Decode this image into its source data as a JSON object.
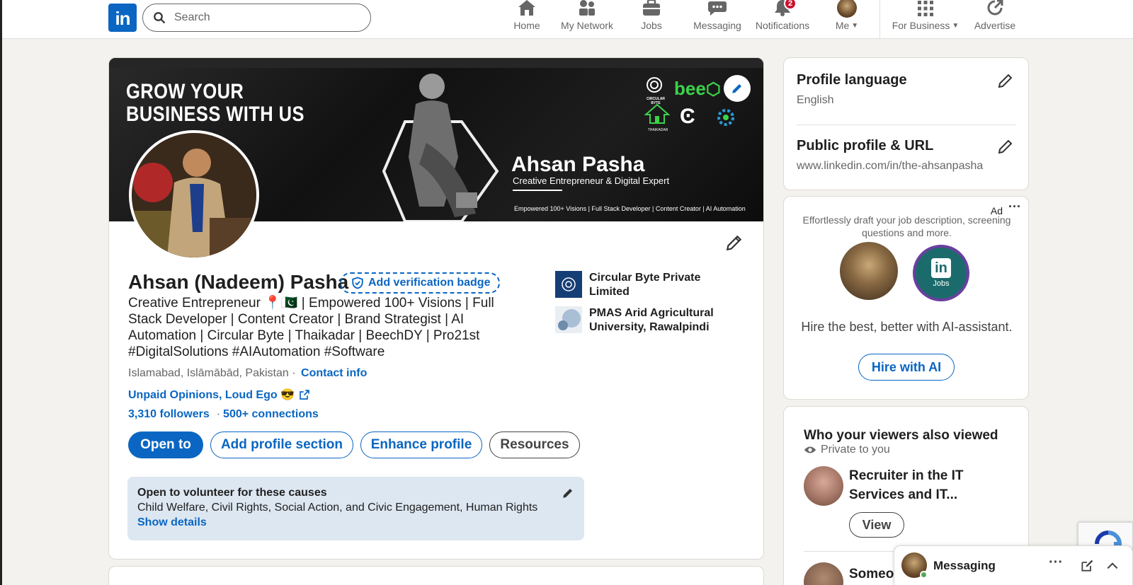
{
  "nav": {
    "logo": "in",
    "search_placeholder": "Search",
    "items": [
      {
        "label": "Home",
        "icon": "home-icon"
      },
      {
        "label": "My Network",
        "icon": "network-icon"
      },
      {
        "label": "Jobs",
        "icon": "briefcase-icon"
      },
      {
        "label": "Messaging",
        "icon": "messaging-icon"
      },
      {
        "label": "Notifications",
        "icon": "bell-icon",
        "badge": "2"
      },
      {
        "label": "Me",
        "icon": "avatar-icon"
      },
      {
        "label": "For Business",
        "icon": "grid-icon"
      },
      {
        "label": "Advertise",
        "icon": "advertise-icon"
      }
    ]
  },
  "banner": {
    "headline_line1": "GROW YOUR",
    "headline_line2": "BUSINESS WITH US",
    "name": "Ahsan Pasha",
    "subtitle": "Creative Entrepreneur & Digital Expert",
    "footer": "Empowered 100+ Visions | Full Stack Developer | Content Creator | AI Automation",
    "brand_text": "bee",
    "logo_captions": [
      "CIRCULAR BYTE",
      "THAIKADAR"
    ]
  },
  "profile": {
    "name": "Ahsan (Nadeem) Pasha",
    "verify_label": "Add verification badge",
    "headline": "Creative Entrepreneur 📍🇵🇰 | Empowered 100+ Visions | Full Stack Developer | Content Creator | Brand Strategist | AI Automation | Circular Byte | Thaikadar | BeechDY | Pro21st #DigitalSolutions #AIAutomation #Software",
    "location": "Islamabad, Islāmābād, Pakistan ·",
    "contact_label": "Contact info",
    "website": "Unpaid Opinions, Loud Ego 😎",
    "followers": "3,310 followers",
    "connections_sep": "·",
    "connections": "500+ connections",
    "buttons": {
      "open_to": "Open to",
      "add_section": "Add profile section",
      "enhance": "Enhance profile",
      "resources": "Resources"
    },
    "orgs": [
      {
        "name": "Circular Byte Private Limited"
      },
      {
        "name": "PMAS Arid Agricultural University, Rawalpindi"
      }
    ],
    "volunteer": {
      "title": "Open to volunteer for these causes",
      "causes": "Child Welfare, Civil Rights, Social Action, and Civic Engagement, Human Rights",
      "link": "Show details"
    }
  },
  "sidebar": {
    "profile_language": {
      "title": "Profile language",
      "value": "English"
    },
    "public_profile": {
      "title": "Public profile & URL",
      "value": "www.linkedin.com/in/the-ahsanpasha"
    },
    "ad": {
      "label": "Ad",
      "text": "Effortlessly draft your job description, screening questions and more.",
      "tagline": "Hire the best, better with AI-assistant.",
      "button": "Hire with AI",
      "logo_word": "in",
      "logo_caption": "Jobs"
    },
    "viewers": {
      "title": "Who your viewers also viewed",
      "private": "Private to you",
      "person1": "Recruiter in the IT Services and IT...",
      "view_button": "View",
      "person2_partial": "Someo"
    }
  },
  "messaging": {
    "label": "Messaging"
  },
  "colors": {
    "brand": "#0a66c2",
    "badge": "#cb112d",
    "page_bg": "#f4f2ee"
  }
}
